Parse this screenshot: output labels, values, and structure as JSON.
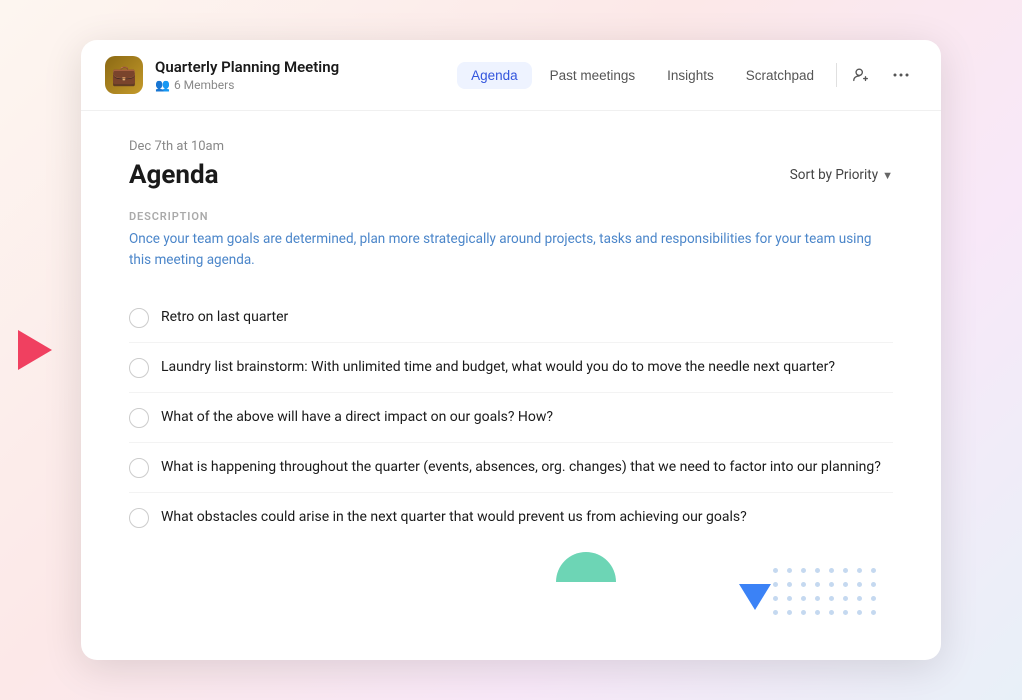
{
  "app": {
    "icon": "💼",
    "title": "Quarterly Planning Meeting",
    "members_label": "6 Members"
  },
  "nav": {
    "tabs": [
      {
        "label": "Agenda",
        "active": true
      },
      {
        "label": "Past meetings",
        "active": false
      },
      {
        "label": "Insights",
        "active": false
      },
      {
        "label": "Scratchpad",
        "active": false
      }
    ]
  },
  "header_actions": {
    "add_member": "add-member-icon",
    "more": "more-icon"
  },
  "agenda": {
    "date": "Dec 7th at 10am",
    "title": "Agenda",
    "sort_label": "Sort by Priority",
    "description_label": "DESCRIPTION",
    "description_text": "Once your team goals are determined, plan more strategically around projects, tasks and responsibilities for your team using this meeting agenda.",
    "items": [
      {
        "text": "Retro on last quarter"
      },
      {
        "text": "Laundry list brainstorm: With unlimited time and budget, what would you do to move the needle next quarter?"
      },
      {
        "text": "What of the above will have a direct impact on our goals? How?"
      },
      {
        "text": "What is happening throughout the quarter (events, absences, org. changes) that we need to factor into our planning?"
      },
      {
        "text": "What obstacles could arise in the next quarter that would prevent us from achieving our goals?"
      }
    ]
  }
}
